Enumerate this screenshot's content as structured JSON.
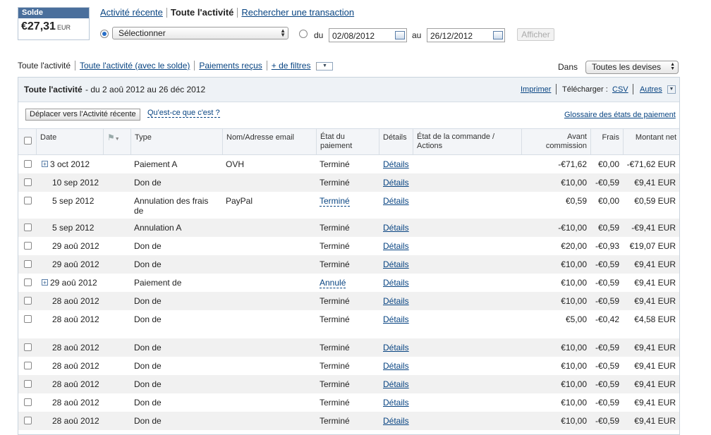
{
  "balance": {
    "label": "Solde",
    "amount": "€27,31",
    "currency": "EUR"
  },
  "top_tabs": [
    "Activité récente",
    "Toute l'activité",
    "Rechercher une transaction"
  ],
  "filter": {
    "select_value": "Sélectionner",
    "from_label": "du",
    "from_date": "02/08/2012",
    "to_label": "au",
    "to_date": "26/12/2012",
    "show_button": "Afficher"
  },
  "sub_tabs": {
    "all": "Toute l'activité",
    "all_balance": "Toute l'activité (avec le solde)",
    "received": "Paiements reçus",
    "more_filters": "+ de filtres"
  },
  "currency": {
    "label": "Dans",
    "value": "Toutes les devises"
  },
  "panel": {
    "title": "Toute l'activité",
    "range": "- du 2 aoû 2012 au 26 déc 2012",
    "print": "Imprimer",
    "download_label": "Télécharger :",
    "csv": "CSV",
    "others": "Autres",
    "move_button": "Déplacer vers l'Activité récente",
    "what_is": "Qu'est-ce que c'est ?",
    "glossary": "Glossaire des états de paiement"
  },
  "columns": {
    "date": "Date",
    "type": "Type",
    "name": "Nom/Adresse email",
    "state_1": "État du",
    "state_2": "paiement",
    "details": "Détails",
    "order_1": "État de la commande /",
    "order_2": "Actions",
    "gross_1": "Avant",
    "gross_2": "commission",
    "fee": "Frais",
    "net": "Montant net"
  },
  "rows": [
    {
      "date": "3 oct 2012",
      "expand": true,
      "type": "Paiement A",
      "type2": "",
      "name": "OVH",
      "state": "Terminé",
      "state_link": false,
      "details": "Détails",
      "gross": "-€71,62",
      "fee": "€0,00",
      "net": "-€71,62 EUR"
    },
    {
      "date": "10 sep 2012",
      "expand": false,
      "type": "Don de",
      "type2": "",
      "name": "",
      "state": "Terminé",
      "state_link": false,
      "details": "Détails",
      "gross": "€10,00",
      "fee": "-€0,59",
      "net": "€9,41 EUR"
    },
    {
      "date": "5 sep 2012",
      "expand": false,
      "type": "Annulation des frais",
      "type2": "de",
      "name": "PayPal",
      "state": "Terminé",
      "state_link": true,
      "details": "Détails",
      "gross": "€0,59",
      "fee": "€0,00",
      "net": "€0,59 EUR"
    },
    {
      "date": "5 sep 2012",
      "expand": false,
      "type": "Annulation A",
      "type2": "",
      "name": "",
      "state": "Terminé",
      "state_link": false,
      "details": "Détails",
      "gross": "-€10,00",
      "fee": "€0,59",
      "net": "-€9,41 EUR"
    },
    {
      "date": "29 aoû 2012",
      "expand": false,
      "type": "Don de",
      "type2": "",
      "name": "",
      "state": "Terminé",
      "state_link": false,
      "details": "Détails",
      "gross": "€20,00",
      "fee": "-€0,93",
      "net": "€19,07 EUR"
    },
    {
      "date": "29 aoû 2012",
      "expand": false,
      "type": "Don de",
      "type2": "",
      "name": "",
      "state": "Terminé",
      "state_link": false,
      "details": "Détails",
      "gross": "€10,00",
      "fee": "-€0,59",
      "net": "€9,41 EUR"
    },
    {
      "date": "29 aoû 2012",
      "expand": true,
      "type": "Paiement de",
      "type2": "",
      "name": "",
      "state": "Annulé",
      "state_link": true,
      "details": "Détails",
      "gross": "€10,00",
      "fee": "-€0,59",
      "net": "€9,41 EUR"
    },
    {
      "date": "28 aoû 2012",
      "expand": false,
      "type": "Don de",
      "type2": "",
      "name": "",
      "state": "Terminé",
      "state_link": false,
      "details": "Détails",
      "gross": "€10,00",
      "fee": "-€0,59",
      "net": "€9,41 EUR"
    },
    {
      "date": "28 aoû 2012",
      "expand": false,
      "type": "Don de",
      "type2": "",
      "name": "",
      "state": "Terminé",
      "state_link": false,
      "details": "Détails",
      "gross": "€5,00",
      "fee": "-€0,42",
      "net": "€4,58 EUR"
    },
    {
      "date": "28 aoû 2012",
      "expand": false,
      "type": "Don de",
      "type2": "",
      "name": "",
      "state": "Terminé",
      "state_link": false,
      "details": "Détails",
      "gross": "€10,00",
      "fee": "-€0,59",
      "net": "€9,41 EUR"
    },
    {
      "date": "28 aoû 2012",
      "expand": false,
      "type": "Don de",
      "type2": "",
      "name": "",
      "state": "Terminé",
      "state_link": false,
      "details": "Détails",
      "gross": "€10,00",
      "fee": "-€0,59",
      "net": "€9,41 EUR"
    },
    {
      "date": "28 aoû 2012",
      "expand": false,
      "type": "Don de",
      "type2": "",
      "name": "",
      "state": "Terminé",
      "state_link": false,
      "details": "Détails",
      "gross": "€10,00",
      "fee": "-€0,59",
      "net": "€9,41 EUR"
    },
    {
      "date": "28 aoû 2012",
      "expand": false,
      "type": "Don de",
      "type2": "",
      "name": "",
      "state": "Terminé",
      "state_link": false,
      "details": "Détails",
      "gross": "€10,00",
      "fee": "-€0,59",
      "net": "€9,41 EUR"
    },
    {
      "date": "28 aoû 2012",
      "expand": false,
      "type": "Don de",
      "type2": "",
      "name": "",
      "state": "Terminé",
      "state_link": false,
      "details": "Détails",
      "gross": "€10,00",
      "fee": "-€0,59",
      "net": "€9,41 EUR"
    }
  ]
}
